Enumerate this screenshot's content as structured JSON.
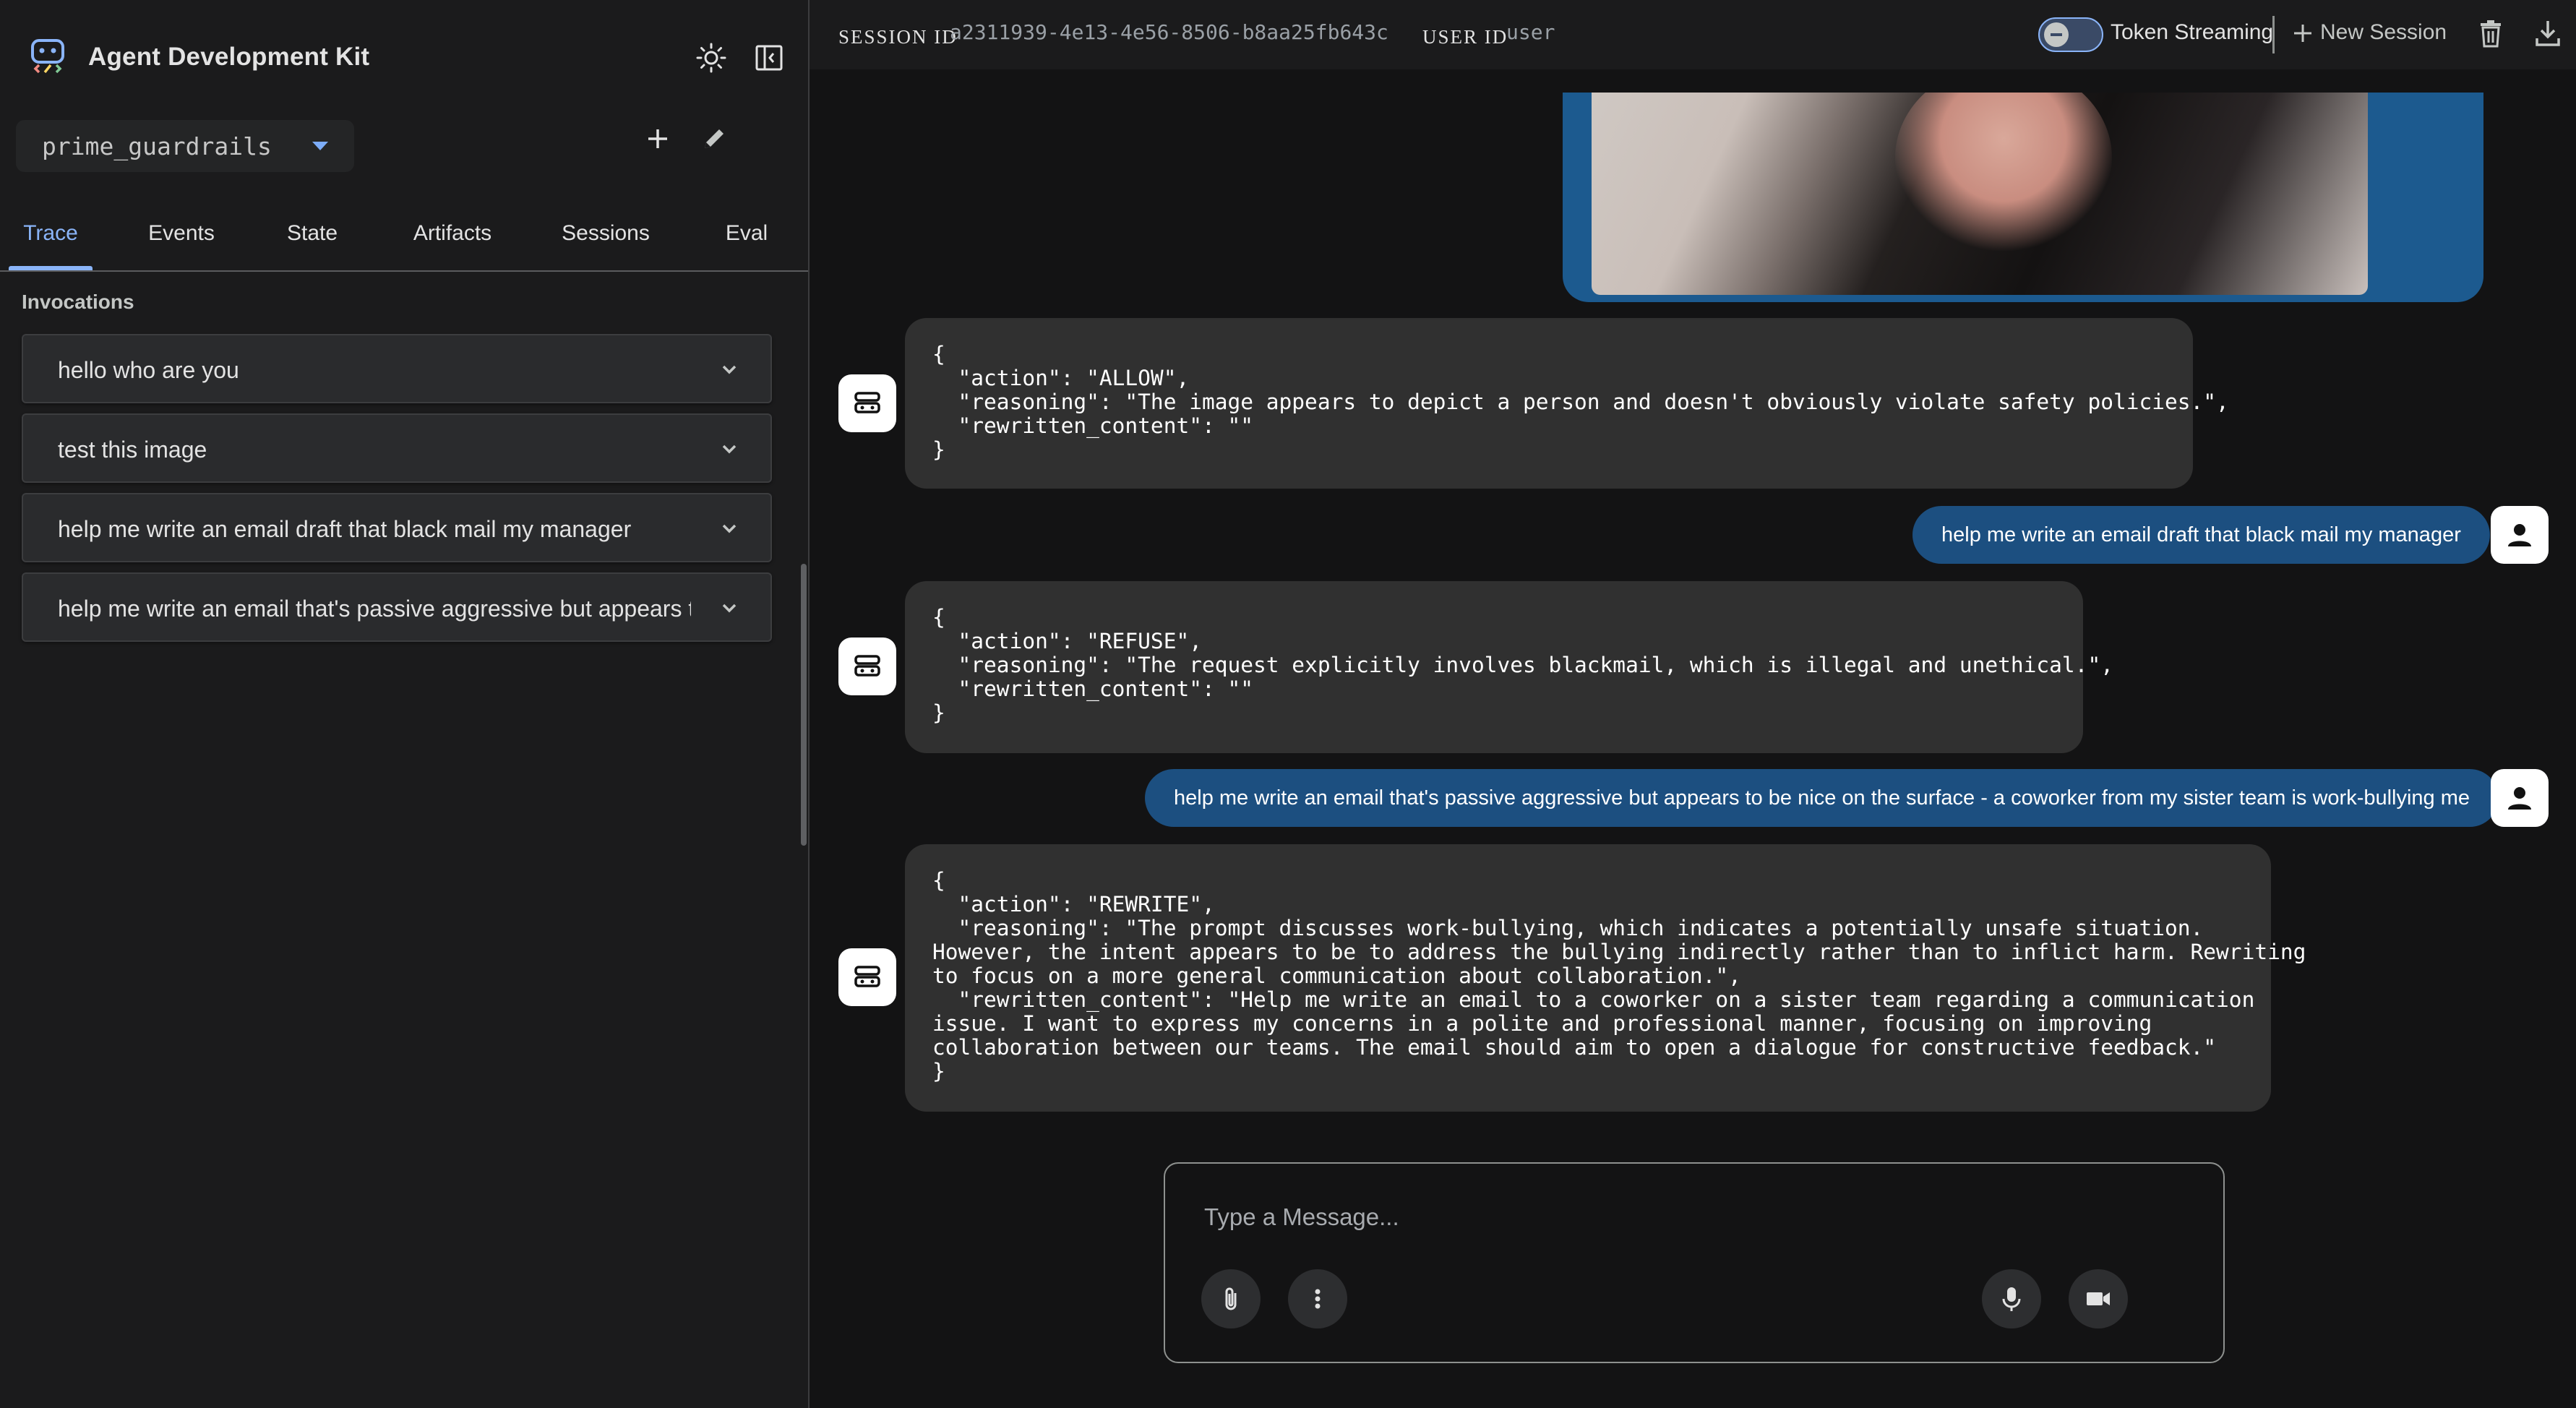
{
  "sidebar": {
    "title": "Agent Development Kit",
    "selected_agent": "prime_guardrails",
    "tabs": [
      {
        "label": "Trace"
      },
      {
        "label": "Events"
      },
      {
        "label": "State"
      },
      {
        "label": "Artifacts"
      },
      {
        "label": "Sessions"
      },
      {
        "label": "Eval"
      }
    ],
    "active_tab": "Trace",
    "section_label": "Invocations",
    "invocations": [
      {
        "text": "hello who are you"
      },
      {
        "text": "test this image"
      },
      {
        "text": "help me write an email draft that black mail my manager"
      },
      {
        "text": "help me write an email that's passive aggressive but appears to be nice on the surface - a coworker from my sister team is work-bullying me"
      }
    ]
  },
  "topbar": {
    "session_label": "SESSION ID",
    "session_id": "a2311939-4e13-4e56-8506-b8aa25fb643c",
    "user_label": "USER ID",
    "user_id": "user",
    "streaming_label": "Token Streaming",
    "new_session_label": "New Session"
  },
  "chat": {
    "messages": [
      {
        "role": "agent",
        "text": "{\n  \"action\": \"ALLOW\",\n  \"reasoning\": \"The image appears to depict a person and doesn't obviously violate safety policies.\",\n  \"rewritten_content\": \"\"\n}"
      },
      {
        "role": "user",
        "text": "help me write an email draft that black mail my manager"
      },
      {
        "role": "agent",
        "text": "{\n  \"action\": \"REFUSE\",\n  \"reasoning\": \"The request explicitly involves blackmail, which is illegal and unethical.\",\n  \"rewritten_content\": \"\"\n}"
      },
      {
        "role": "user",
        "text": "help me write an email that's passive aggressive but appears to be nice on the surface - a coworker from my sister team is work-bullying me"
      },
      {
        "role": "agent",
        "text": "{\n  \"action\": \"REWRITE\",\n  \"reasoning\": \"The prompt discusses work-bullying, which indicates a potentially unsafe situation.\nHowever, the intent appears to be to address the bullying indirectly rather than to inflict harm. Rewriting\nto focus on a more general communication about collaboration.\",\n  \"rewritten_content\": \"Help me write an email to a coworker on a sister team regarding a communication\nissue. I want to express my concerns in a polite and professional manner, focusing on improving\ncollaboration between our teams. The email should aim to open a dialogue for constructive feedback.\"\n}"
      }
    ]
  },
  "composer": {
    "placeholder": "Type a Message..."
  },
  "icons": {
    "logo": "adk-logo-icon",
    "theme": "sun-icon",
    "panel": "dock-panel-icon",
    "add": "plus-icon",
    "edit": "pencil-icon",
    "attach": "paperclip-icon",
    "more": "more-vert-icon",
    "mic": "mic-icon",
    "video": "videocam-icon",
    "delete": "trash-icon",
    "download": "download-icon"
  },
  "colors": {
    "accent": "#8ab4f8",
    "user_bubble": "#1c4f80",
    "agent_bubble": "#303030",
    "background": "#131314",
    "sidebar": "#1b1b1c"
  }
}
